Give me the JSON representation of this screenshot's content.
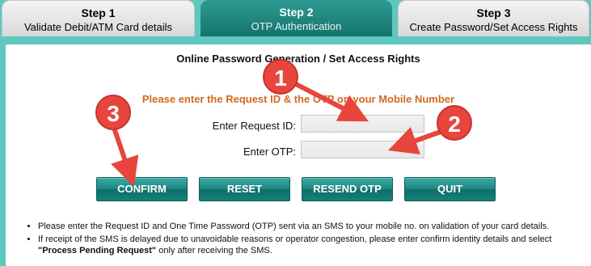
{
  "tabs": [
    {
      "step": "Step 1",
      "label": "Validate Debit/ATM Card details",
      "active": false
    },
    {
      "step": "Step 2",
      "label": "OTP Authentication",
      "active": true
    },
    {
      "step": "Step 3",
      "label": "Create Password/Set Access Rights",
      "active": false
    }
  ],
  "form": {
    "title": "Online Password Generation / Set Access Rights",
    "instruction": "Please enter the Request ID & the OTP           on your Mobile Number",
    "request_id_label": "Enter Request ID:",
    "request_id_value": "",
    "otp_label": "Enter OTP:",
    "otp_value": ""
  },
  "buttons": {
    "confirm": "CONFIRM",
    "reset": "RESET",
    "resend_otp": "RESEND OTP",
    "quit": "QUIT"
  },
  "notes": {
    "line1": "Please enter the Request ID and One Time Password (OTP) sent via an SMS to your mobile no. on validation of your card details.",
    "line2_prefix": "If receipt of the SMS is delayed due to unavoidable reasons or operator congestion, please enter confirm identity details and select",
    "line2_bold": "\"Process Pending Request\"",
    "line2_suffix": "only after receiving the SMS."
  },
  "callouts": {
    "one": "1",
    "two": "2",
    "three": "3"
  },
  "colors": {
    "page_bg": "#5ec8bf",
    "active_tab": "#1f8780",
    "button": "#1f8a83",
    "instruction_text": "#d2691e",
    "callout": "#e8453d"
  }
}
